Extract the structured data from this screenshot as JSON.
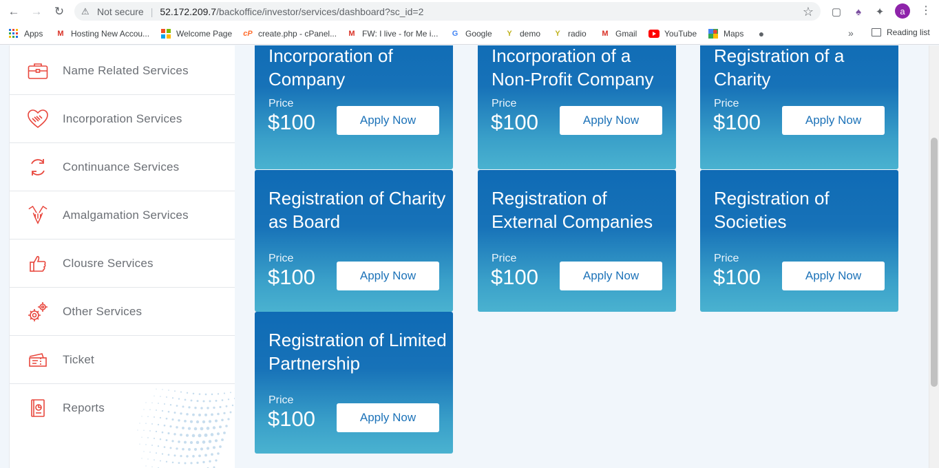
{
  "browser": {
    "not_secure": "Not secure",
    "url_host": "52.172.209.7",
    "url_path": "/backoffice/investor/services/dashboard?sc_id=2",
    "avatar_letter": "a",
    "bookmarks": [
      {
        "label": "Apps",
        "icon": "apps-grid-icon"
      },
      {
        "label": "Hosting New Accou...",
        "icon": "gmail-icon"
      },
      {
        "label": "Welcome Page",
        "icon": "windows-icon"
      },
      {
        "label": "create.php - cPanel...",
        "icon": "cpanel-icon"
      },
      {
        "label": "FW: I live - for Me i...",
        "icon": "gmail-icon"
      },
      {
        "label": "Google",
        "icon": "google-icon"
      },
      {
        "label": "demo",
        "icon": "yammer-icon"
      },
      {
        "label": "radio",
        "icon": "yammer-icon"
      },
      {
        "label": "Gmail",
        "icon": "gmail-icon"
      },
      {
        "label": "YouTube",
        "icon": "youtube-icon"
      },
      {
        "label": "Maps",
        "icon": "maps-icon"
      }
    ],
    "more": "»",
    "reading_list": "Reading list"
  },
  "sidebar": {
    "items": [
      {
        "label": "Name Related Services",
        "icon": "briefcase-icon"
      },
      {
        "label": "Incorporation Services",
        "icon": "heart-handshake-icon"
      },
      {
        "label": "Continuance Services",
        "icon": "refresh-cycle-icon"
      },
      {
        "label": "Amalgamation Services",
        "icon": "merge-hands-icon"
      },
      {
        "label": "Clousre Services",
        "icon": "thumbs-up-icon"
      },
      {
        "label": "Other Services",
        "icon": "gears-icon"
      },
      {
        "label": "Ticket",
        "icon": "ticket-icon"
      },
      {
        "label": "Reports",
        "icon": "report-document-icon"
      }
    ]
  },
  "services": [
    {
      "title": "Incorporation of Company",
      "price_label": "Price",
      "price": "$100",
      "button": "Apply Now"
    },
    {
      "title": "Incorporation of a Non-Profit Company",
      "price_label": "Price",
      "price": "$100",
      "button": "Apply Now"
    },
    {
      "title": "Registration of a Charity",
      "price_label": "Price",
      "price": "$100",
      "button": "Apply Now"
    },
    {
      "title": "Registration of Charity as Board",
      "price_label": "Price",
      "price": "$100",
      "button": "Apply Now"
    },
    {
      "title": "Registration of External Companies",
      "price_label": "Price",
      "price": "$100",
      "button": "Apply Now"
    },
    {
      "title": "Registration of Societies",
      "price_label": "Price",
      "price": "$100",
      "button": "Apply Now"
    },
    {
      "title": "Registration of Limited Partnership",
      "price_label": "Price",
      "price": "$100",
      "button": "Apply Now"
    }
  ],
  "colors": {
    "accent_red": "#e8463c",
    "card_top": "#0f6bb5",
    "card_bottom": "#4ab2d0",
    "button_text": "#1c72b8"
  }
}
